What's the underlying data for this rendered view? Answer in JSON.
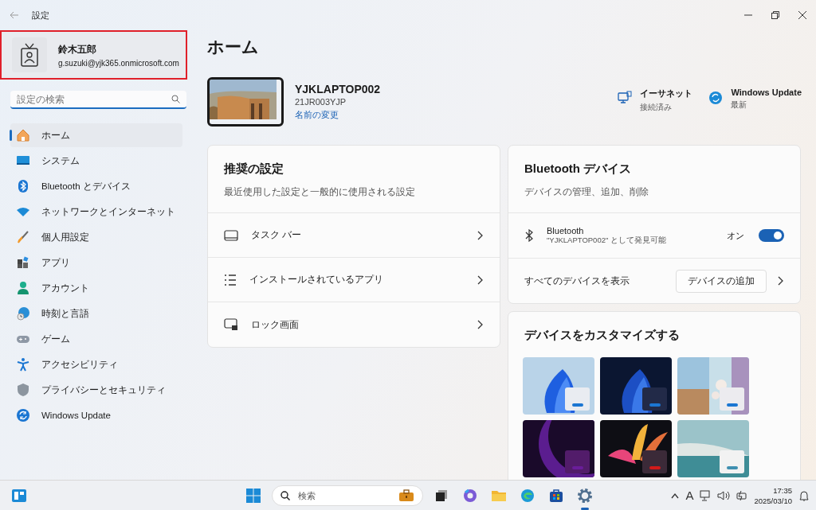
{
  "window": {
    "title": "設定"
  },
  "user": {
    "name": "鈴木五郎",
    "email": "g.suzuki@yjk365.onmicrosoft.com"
  },
  "search": {
    "placeholder": "設定の検索"
  },
  "nav": [
    {
      "label": "ホーム",
      "selected": true
    },
    {
      "label": "システム",
      "selected": false
    },
    {
      "label": "Bluetooth とデバイス",
      "selected": false
    },
    {
      "label": "ネットワークとインターネット",
      "selected": false
    },
    {
      "label": "個人用設定",
      "selected": false
    },
    {
      "label": "アプリ",
      "selected": false
    },
    {
      "label": "アカウント",
      "selected": false
    },
    {
      "label": "時刻と言語",
      "selected": false
    },
    {
      "label": "ゲーム",
      "selected": false
    },
    {
      "label": "アクセシビリティ",
      "selected": false
    },
    {
      "label": "プライバシーとセキュリティ",
      "selected": false
    },
    {
      "label": "Windows Update",
      "selected": false
    }
  ],
  "page_title": "ホーム",
  "device": {
    "name": "YJKLAPTOP002",
    "model": "21JR003YJP",
    "rename_link": "名前の変更"
  },
  "status": [
    {
      "title": "イーサネット",
      "detail": "接続済み"
    },
    {
      "title": "Windows Update",
      "detail": "最新"
    }
  ],
  "recommended": {
    "title": "推奨の設定",
    "subtitle": "最近使用した設定と一般的に使用される設定",
    "items": [
      {
        "label": "タスク バー"
      },
      {
        "label": "インストールされているアプリ"
      },
      {
        "label": "ロック画面"
      }
    ]
  },
  "bluetooth_card": {
    "title": "Bluetooth デバイス",
    "subtitle": "デバイスの管理、追加、削除",
    "toggle": {
      "label": "Bluetooth",
      "detail": "\"YJKLAPTOP002\" として発見可能",
      "state_label": "オン",
      "on": true
    },
    "view_all": "すべてのデバイスを表示",
    "add_button": "デバイスの追加"
  },
  "customize": {
    "title": "デバイスをカスタマイズする"
  },
  "taskbar": {
    "search_placeholder": "検索",
    "ime": "A",
    "time": "17:35",
    "date": "2025/03/10"
  }
}
